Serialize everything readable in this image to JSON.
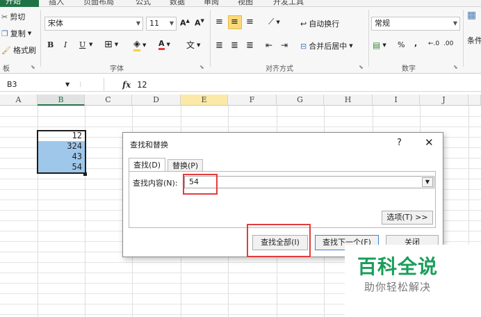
{
  "ribbon": {
    "tabs": [
      "开始",
      "插入",
      "页面布局",
      "公式",
      "数据",
      "审阅",
      "视图",
      "开发工具"
    ],
    "clipboard": {
      "cut": "剪切",
      "copy": "复制",
      "format_painter": "格式刷",
      "group_label": "板"
    },
    "font": {
      "name": "宋体",
      "size": "11",
      "bold": "B",
      "italic": "I",
      "underline": "U",
      "group_label": "字体"
    },
    "alignment": {
      "wrap": "自动换行",
      "merge": "合并后居中",
      "group_label": "对齐方式"
    },
    "number": {
      "format": "常规",
      "percent": "%",
      "comma": ",",
      "group_label": "数字"
    },
    "styles": {
      "conditional": "条件"
    }
  },
  "formula_bar": {
    "cell_ref": "B3",
    "fx": "fx",
    "value": "12"
  },
  "columns": [
    "A",
    "B",
    "C",
    "D",
    "E",
    "F",
    "G",
    "H",
    "I",
    "J"
  ],
  "cells": [
    "12",
    "324",
    "43",
    "54"
  ],
  "dialog": {
    "title": "查找和替换",
    "help": "?",
    "close": "✕",
    "tab_find": "查找(D)",
    "tab_replace": "替换(P)",
    "find_label": "查找内容(N):",
    "find_value": "54",
    "options": "选项(T) >>",
    "find_all": "查找全部(I)",
    "find_next": "查找下一个(F)",
    "close_btn": "关闭"
  },
  "watermark": {
    "title": "百科全说",
    "subtitle": "助你轻松解决"
  },
  "colors": {
    "accent": "#217346",
    "highlight": "#9ec7ea",
    "annotation": "#e23c3c",
    "watermark": "#1a9e5a"
  }
}
